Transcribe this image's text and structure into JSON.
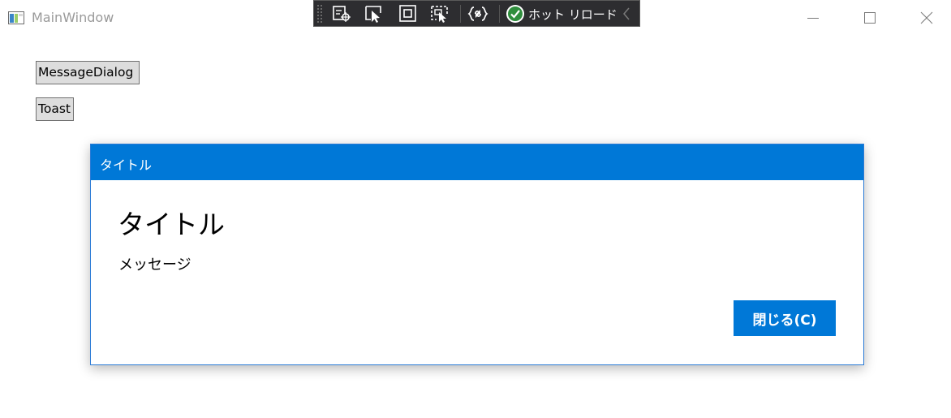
{
  "window": {
    "title": "MainWindow",
    "controls": [
      "minimize",
      "maximize",
      "close"
    ]
  },
  "debug_toolbar": {
    "icons": [
      "live-visual-tree-icon",
      "select-element-icon",
      "display-layout-adorners-icon",
      "track-focus-icon",
      "binding-failures-icon"
    ],
    "hot_reload_label": "ホット リロード",
    "hot_reload_status": "ok"
  },
  "main": {
    "buttons": [
      {
        "label": "MessageDialog"
      },
      {
        "label": "Toast"
      }
    ]
  },
  "dialog": {
    "header_title": "タイトル",
    "title": "タイトル",
    "message": "メッセージ",
    "close_label": "閉じる(C)",
    "accent_color": "#0078d7"
  }
}
